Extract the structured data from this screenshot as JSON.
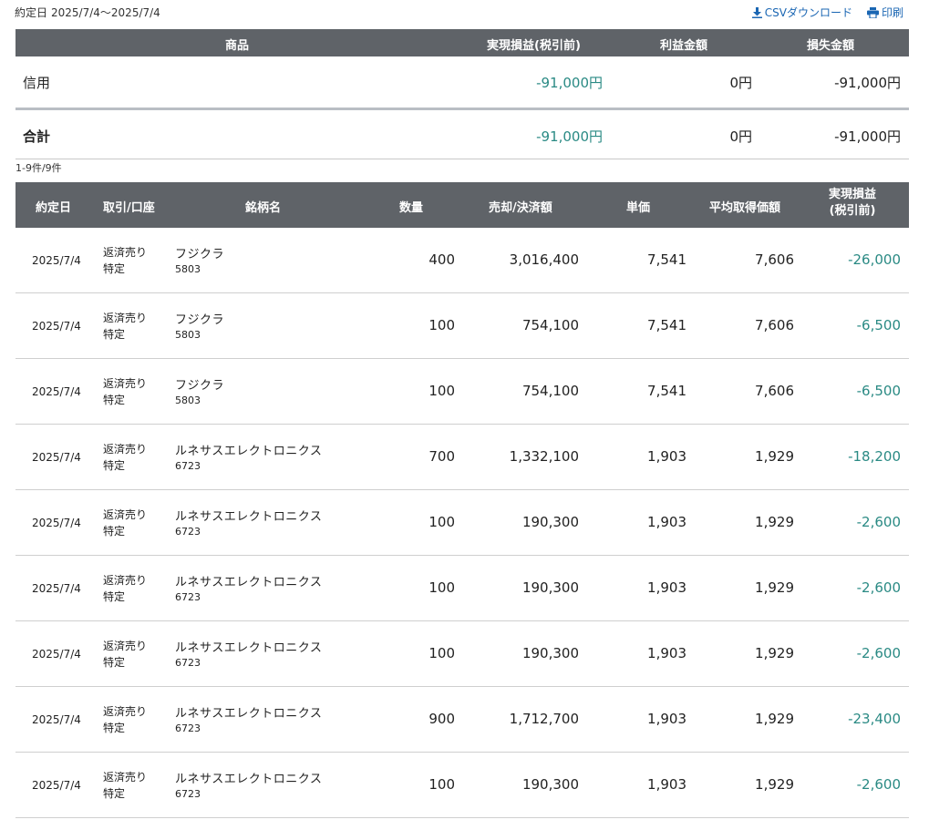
{
  "header": {
    "period_label": "約定日",
    "period_value": "2025/7/4〜2025/7/4",
    "csv_label": "CSVダウンロード",
    "print_label": "印刷",
    "csv_icon": "download-icon",
    "print_icon": "printer-icon"
  },
  "summary": {
    "columns": [
      "商品",
      "実現損益(税引前)",
      "利益金額",
      "損失金額"
    ],
    "rows": [
      {
        "product": "信用",
        "realized": "-91,000円",
        "profit": "0円",
        "loss": "-91,000円"
      }
    ],
    "total": {
      "product": "合計",
      "realized": "-91,000円",
      "profit": "0円",
      "loss": "-91,000円"
    }
  },
  "count_text": "1-9件/9件",
  "detail": {
    "columns": {
      "date": "約定日",
      "trade": "取引/口座",
      "name": "銘柄名",
      "qty": "数量",
      "amount": "売却/決済額",
      "price": "単価",
      "avg": "平均取得価額",
      "pl_line1": "実現損益",
      "pl_line2": "(税引前)"
    },
    "rows": [
      {
        "date": "2025/7/4",
        "trade": "返済売り",
        "account": "特定",
        "name": "フジクラ",
        "code": "5803",
        "qty": "400",
        "amount": "3,016,400",
        "price": "7,541",
        "avg": "7,606",
        "pl": "-26,000"
      },
      {
        "date": "2025/7/4",
        "trade": "返済売り",
        "account": "特定",
        "name": "フジクラ",
        "code": "5803",
        "qty": "100",
        "amount": "754,100",
        "price": "7,541",
        "avg": "7,606",
        "pl": "-6,500"
      },
      {
        "date": "2025/7/4",
        "trade": "返済売り",
        "account": "特定",
        "name": "フジクラ",
        "code": "5803",
        "qty": "100",
        "amount": "754,100",
        "price": "7,541",
        "avg": "7,606",
        "pl": "-6,500"
      },
      {
        "date": "2025/7/4",
        "trade": "返済売り",
        "account": "特定",
        "name": "ルネサスエレクトロニクス",
        "code": "6723",
        "qty": "700",
        "amount": "1,332,100",
        "price": "1,903",
        "avg": "1,929",
        "pl": "-18,200"
      },
      {
        "date": "2025/7/4",
        "trade": "返済売り",
        "account": "特定",
        "name": "ルネサスエレクトロニクス",
        "code": "6723",
        "qty": "100",
        "amount": "190,300",
        "price": "1,903",
        "avg": "1,929",
        "pl": "-2,600"
      },
      {
        "date": "2025/7/4",
        "trade": "返済売り",
        "account": "特定",
        "name": "ルネサスエレクトロニクス",
        "code": "6723",
        "qty": "100",
        "amount": "190,300",
        "price": "1,903",
        "avg": "1,929",
        "pl": "-2,600"
      },
      {
        "date": "2025/7/4",
        "trade": "返済売り",
        "account": "特定",
        "name": "ルネサスエレクトロニクス",
        "code": "6723",
        "qty": "100",
        "amount": "190,300",
        "price": "1,903",
        "avg": "1,929",
        "pl": "-2,600"
      },
      {
        "date": "2025/7/4",
        "trade": "返済売り",
        "account": "特定",
        "name": "ルネサスエレクトロニクス",
        "code": "6723",
        "qty": "900",
        "amount": "1,712,700",
        "price": "1,903",
        "avg": "1,929",
        "pl": "-23,400"
      },
      {
        "date": "2025/7/4",
        "trade": "返済売り",
        "account": "特定",
        "name": "ルネサスエレクトロニクス",
        "code": "6723",
        "qty": "100",
        "amount": "190,300",
        "price": "1,903",
        "avg": "1,929",
        "pl": "-2,600"
      }
    ]
  },
  "colors": {
    "header_bg": "#5f6368",
    "loss_text": "#2a8a84",
    "link": "#1a66b3"
  }
}
